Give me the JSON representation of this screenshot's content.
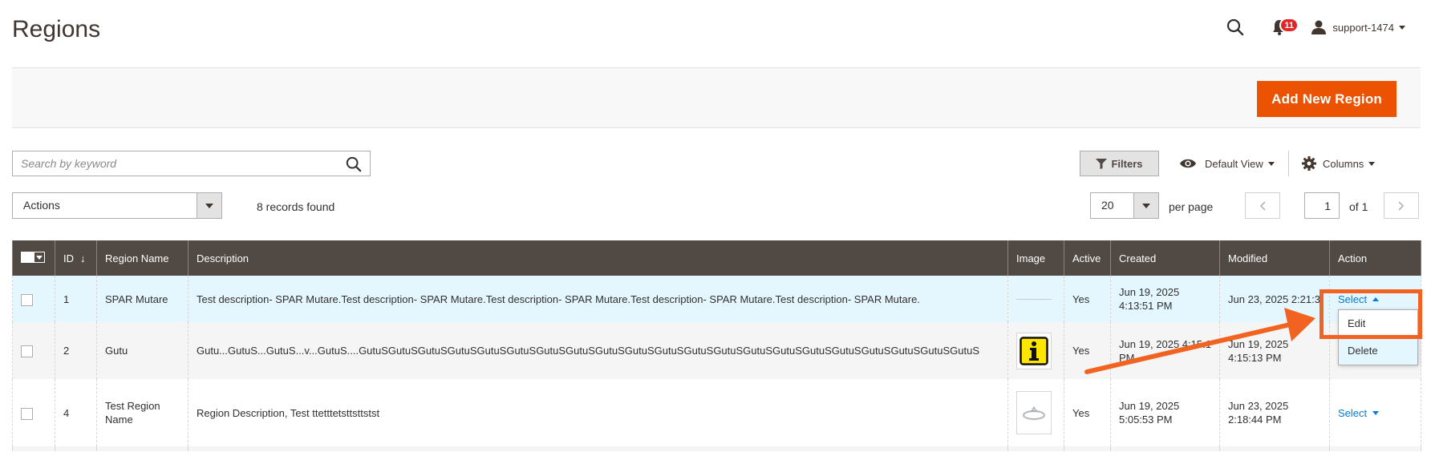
{
  "header": {
    "title": "Regions",
    "notification_count": "11",
    "username": "support-1474"
  },
  "toolbar": {
    "add_button_label": "Add New Region",
    "search_placeholder": "Search by keyword",
    "filters_label": "Filters",
    "view_label": "Default View",
    "columns_label": "Columns",
    "actions_label": "Actions",
    "records_found": "8 records found",
    "per_page_value": "20",
    "per_page_label": "per page",
    "current_page": "1",
    "page_total": "of 1"
  },
  "grid": {
    "columns": {
      "id": "ID",
      "name": "Region Name",
      "description": "Description",
      "image": "Image",
      "active": "Active",
      "created": "Created",
      "modified": "Modified",
      "action": "Action"
    },
    "sort_arrow": "↓",
    "rows": [
      {
        "id": "1",
        "name": "SPAR Mutare",
        "description": "Test description- SPAR Mutare.Test description- SPAR Mutare.Test description- SPAR Mutare.Test description- SPAR Mutare.Test description- SPAR Mutare.",
        "image": "none",
        "active": "Yes",
        "created": "Jun 19, 2025 4:13:51 PM",
        "modified": "Jun 23, 2025 2:21:3",
        "action_label": "Select",
        "menu_open": true
      },
      {
        "id": "2",
        "name": "Gutu",
        "description": "Gutu...GutuS...GutuS...v...GutuS....GutuSGutuSGutuSGutuSGutuSGutuSGutuSGutuSGutuSGutuSGutuSGutuSGutuSGutuSGutuSGutuSGutuSGutuSGutuSGutuSGutuS",
        "image": "info-icon",
        "active": "Yes",
        "created": "Jun 19, 2025 4:15:1",
        "created_line2": "PM",
        "modified": "Jun 19, 2025 4:15:13 PM",
        "action_label": "Select"
      },
      {
        "id": "4",
        "name": "Test Region Name",
        "description": "Region Description, Test ttetttetsttsttstst",
        "image": "ring-photo",
        "active": "Yes",
        "created": "Jun 19, 2025 5:05:53 PM",
        "modified": "Jun 23, 2025 2:18:44 PM",
        "action_label": "Select"
      }
    ]
  },
  "action_menu": {
    "items": [
      "Edit",
      "Delete"
    ]
  },
  "colors": {
    "accent": "#eb5202",
    "header_bg": "#514943",
    "link": "#007bdb",
    "annotation": "#f26322",
    "badge": "#e22626"
  }
}
